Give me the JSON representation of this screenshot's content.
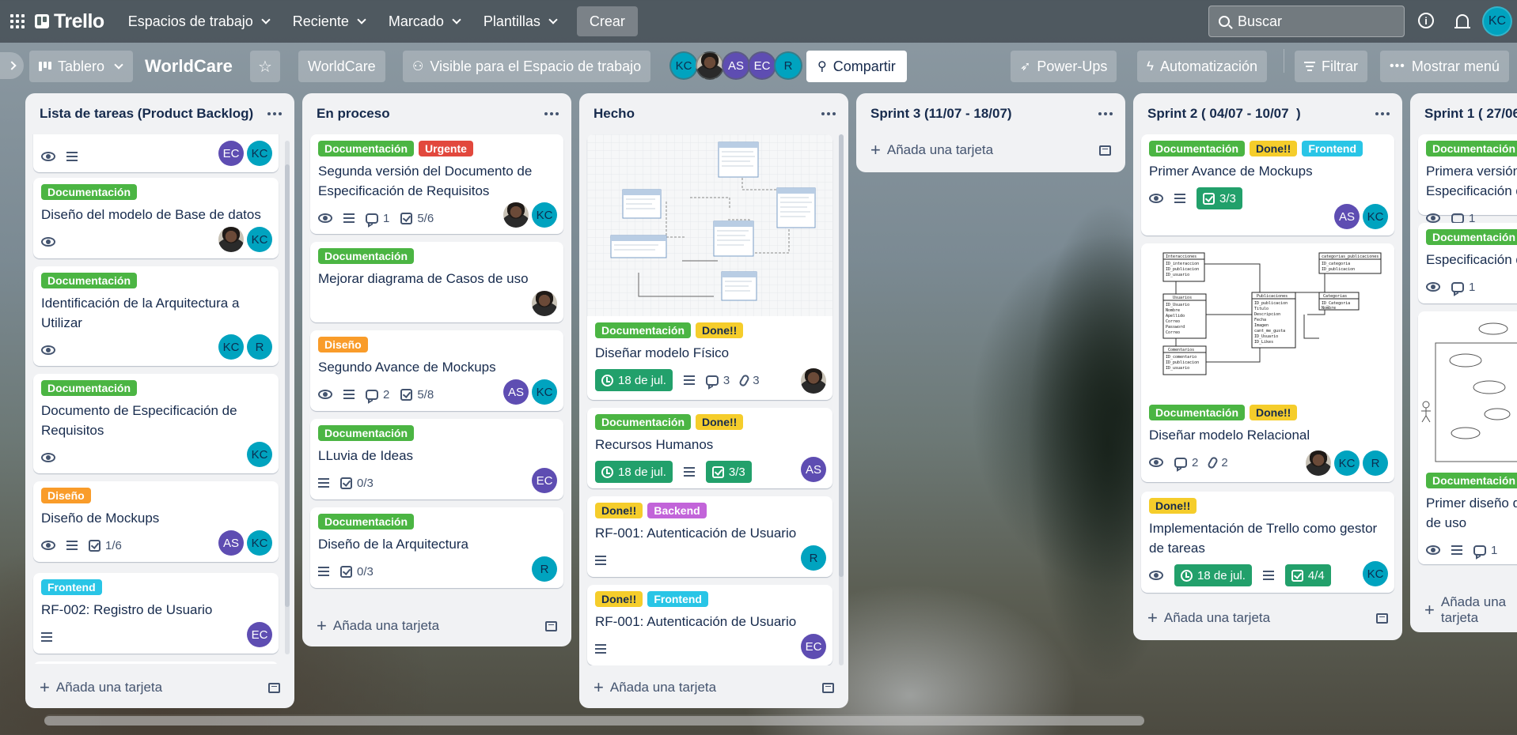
{
  "nav": {
    "logo": "Trello",
    "menus": [
      "Espacios de trabajo",
      "Reciente",
      "Marcado",
      "Plantillas"
    ],
    "create": "Crear",
    "search_placeholder": "Buscar",
    "me_initials": "KC"
  },
  "board": {
    "view": "Tablero",
    "title": "WorldCare",
    "workspace": "WorldCare",
    "visibility": "Visible para el Espacio de trabajo",
    "members": [
      "KC",
      "photo",
      "AS",
      "EC",
      "R"
    ],
    "share": "Compartir",
    "powerups": "Power-Ups",
    "automation": "Automatización",
    "filter": "Filtrar",
    "menu": "Mostrar menú"
  },
  "add_card": "Añada una tarjeta",
  "lists": [
    {
      "title": "Lista de tareas (Product Backlog)",
      "cards": [
        {
          "labels": [],
          "title": "",
          "badges": {
            "watch": true,
            "desc": true
          },
          "members": [
            "EC",
            "KC"
          ]
        },
        {
          "labels": [
            {
              "t": "Documentación",
              "c": "green"
            }
          ],
          "title": "Diseño del modelo de Base de datos",
          "badges": {
            "watch": true
          },
          "members": [
            "photo",
            "KC"
          ]
        },
        {
          "labels": [
            {
              "t": "Documentación",
              "c": "green"
            }
          ],
          "title": "Identificación de la Arquitectura a Utilizar",
          "badges": {
            "watch": true
          },
          "members": [
            "KC",
            "R"
          ]
        },
        {
          "labels": [
            {
              "t": "Documentación",
              "c": "green"
            }
          ],
          "title": "Documento de Especificación de Requisitos",
          "badges": {
            "watch": true
          },
          "members": [
            "KC"
          ]
        },
        {
          "labels": [
            {
              "t": "Diseño",
              "c": "orange"
            }
          ],
          "title": "Diseño de Mockups",
          "badges": {
            "watch": true,
            "desc": true,
            "check": "1/6"
          },
          "members": [
            "AS",
            "KC"
          ]
        },
        {
          "labels": [
            {
              "t": "Frontend",
              "c": "cyan"
            }
          ],
          "title": "RF-002: Registro de Usuario",
          "badges": {
            "desc": true
          },
          "members": [
            "EC"
          ]
        }
      ]
    },
    {
      "title": "En proceso",
      "cards": [
        {
          "labels": [
            {
              "t": "Documentación",
              "c": "green"
            },
            {
              "t": "Urgente",
              "c": "red"
            }
          ],
          "title": "Segunda versión del Documento de Especificación de Requisitos",
          "badges": {
            "watch": true,
            "desc": true,
            "comments": "1",
            "check": "5/6"
          },
          "members": [
            "photo",
            "KC"
          ]
        },
        {
          "labels": [
            {
              "t": "Documentación",
              "c": "green"
            }
          ],
          "title": "Mejorar diagrama de Casos de uso",
          "badges": {},
          "members": [
            "photo"
          ]
        },
        {
          "labels": [
            {
              "t": "Diseño",
              "c": "orange"
            }
          ],
          "title": "Segundo Avance de Mockups",
          "badges": {
            "watch": true,
            "desc": true,
            "comments": "2",
            "check": "5/8"
          },
          "members": [
            "AS",
            "KC"
          ]
        },
        {
          "labels": [
            {
              "t": "Documentación",
              "c": "green"
            }
          ],
          "title": "LLuvia de Ideas",
          "badges": {
            "desc": true,
            "check": "0/3"
          },
          "members": [
            "EC"
          ]
        },
        {
          "labels": [
            {
              "t": "Documentación",
              "c": "green"
            }
          ],
          "title": "Diseño de la Arquitectura",
          "badges": {
            "desc": true,
            "check": "0/3"
          },
          "members": [
            "R"
          ]
        }
      ]
    },
    {
      "title": "Hecho",
      "cards": [
        {
          "labels": [
            {
              "t": "Documentación",
              "c": "green"
            },
            {
              "t": "Done!!",
              "c": "yellow"
            }
          ],
          "title": "Diseñar modelo Físico",
          "badges": {
            "date": "18 de jul.",
            "desc": true,
            "comments": "3",
            "attach": "3"
          },
          "members": [
            "photo"
          ]
        },
        {
          "labels": [
            {
              "t": "Documentación",
              "c": "green"
            },
            {
              "t": "Done!!",
              "c": "yellow"
            }
          ],
          "title": "Recursos Humanos",
          "badges": {
            "date": "18 de jul.",
            "desc": true,
            "check_done": "3/3"
          },
          "members": [
            "AS"
          ]
        },
        {
          "labels": [
            {
              "t": "Done!!",
              "c": "yellow"
            },
            {
              "t": "Backend",
              "c": "purple"
            }
          ],
          "title": "RF-001: Autenticación de Usuario",
          "badges": {
            "desc": true
          },
          "members": [
            "R"
          ]
        },
        {
          "labels": [
            {
              "t": "Done!!",
              "c": "yellow"
            },
            {
              "t": "Frontend",
              "c": "cyan"
            }
          ],
          "title": "RF-001: Autenticación de Usuario",
          "badges": {
            "desc": true
          },
          "members": [
            "EC"
          ]
        }
      ]
    },
    {
      "title": "Sprint 3 (11/07 - 18/07)",
      "cards": []
    },
    {
      "title": "Sprint 2 ( 04/07 - 10/07  )",
      "cards": [
        {
          "labels": [
            {
              "t": "Documentación",
              "c": "green"
            },
            {
              "t": "Done!!",
              "c": "yellow"
            },
            {
              "t": "Frontend",
              "c": "cyan"
            }
          ],
          "title": "Primer Avance de Mockups",
          "badges": {
            "watch": true,
            "desc": true,
            "check_done": "3/3"
          },
          "members": [
            "AS",
            "KC"
          ]
        },
        {
          "labels": [
            {
              "t": "Documentación",
              "c": "green"
            },
            {
              "t": "Done!!",
              "c": "yellow"
            }
          ],
          "title": "Diseñar modelo Relacional",
          "badges": {
            "watch": true,
            "comments": "2",
            "attach": "2"
          },
          "members": [
            "photo",
            "KC",
            "R"
          ]
        },
        {
          "labels": [
            {
              "t": "Done!!",
              "c": "yellow"
            }
          ],
          "title": "Implementación de Trello como gestor de tareas",
          "badges": {
            "watch": true,
            "date": "18 de jul.",
            "desc": true,
            "check_done": "4/4"
          },
          "members": [
            "KC"
          ]
        }
      ]
    },
    {
      "title": "Sprint 1 ( 27/06",
      "cards": [
        {
          "labels": [
            {
              "t": "Documentación",
              "c": "green"
            }
          ],
          "title": "Primera versión Especificación d",
          "badges": {
            "watch": true,
            "comments": "1"
          },
          "members": []
        },
        {
          "labels": [
            {
              "t": "Documentación",
              "c": "green"
            }
          ],
          "title": "Especificación d",
          "badges": {
            "watch": true,
            "comments": "1"
          },
          "members": []
        },
        {
          "labels": [
            {
              "t": "Documentación",
              "c": "green"
            }
          ],
          "title": "Primer diseño d de uso",
          "badges": {
            "watch": true,
            "desc": true,
            "comments": "1"
          },
          "members": []
        }
      ]
    }
  ]
}
